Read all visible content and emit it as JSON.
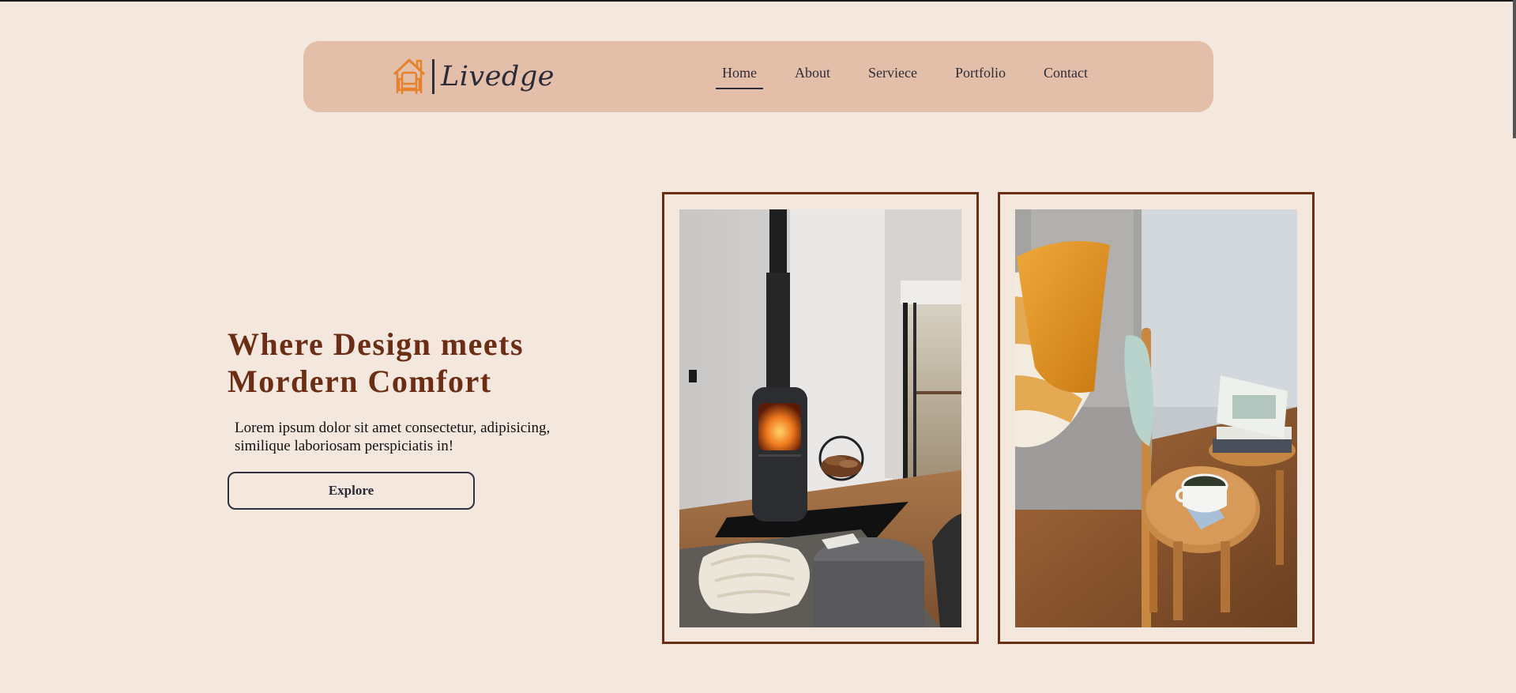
{
  "brand": {
    "name": "Livedge",
    "logo_icon": "house-armchair-icon",
    "accent_color": "#e8822a"
  },
  "nav": {
    "items": [
      {
        "label": "Home",
        "active": true
      },
      {
        "label": "About",
        "active": false
      },
      {
        "label": "Serviece",
        "active": false
      },
      {
        "label": "Portfolio",
        "active": false
      },
      {
        "label": "Contact",
        "active": false
      }
    ]
  },
  "hero": {
    "title_line_1": "Where Design meets",
    "title_line_2": "Mordern Comfort",
    "subtitle": "Lorem ipsum dolor sit amet consectetur, adipisicing, similique laboriosam perspiciatis in!",
    "button_label": "Explore"
  },
  "gallery": {
    "images": [
      {
        "subject": "wood-stove-fireplace-room"
      },
      {
        "subject": "armchair-with-pillows-and-side-table"
      }
    ]
  },
  "colors": {
    "page_bg": "#f3e7de",
    "nav_bg": "#e3bea8",
    "title": "#6b2d14",
    "frame_border": "#6b2d14"
  }
}
